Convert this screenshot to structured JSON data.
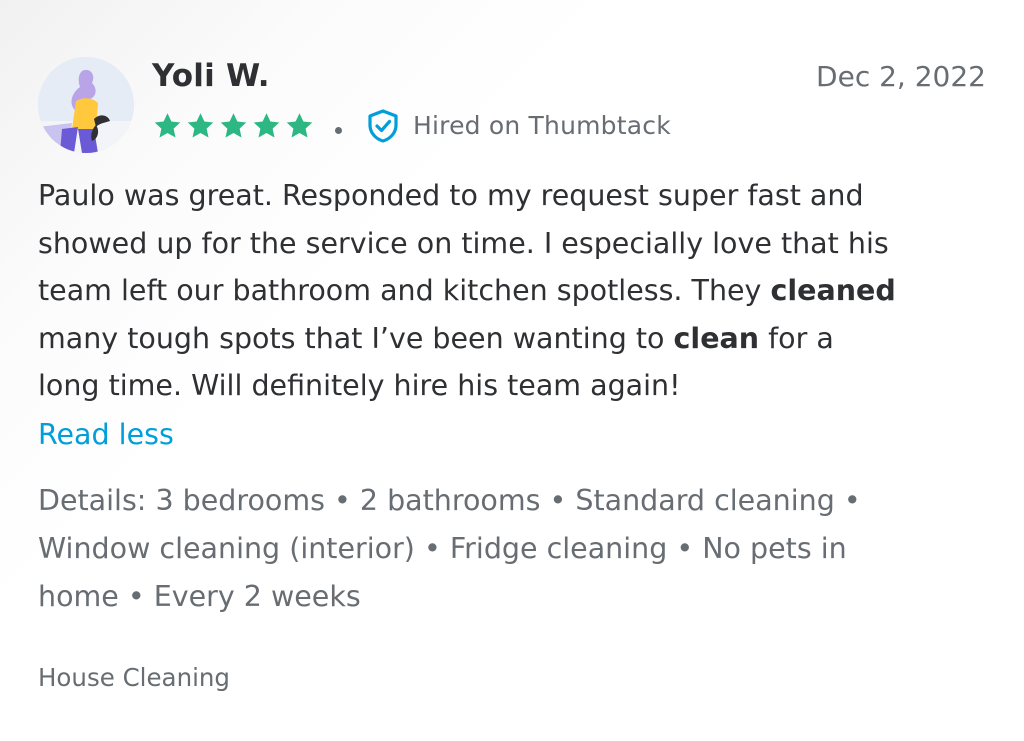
{
  "review": {
    "reviewer_name": "Yoli W.",
    "date": "Dec 2, 2022",
    "rating": 5,
    "rating_max": 5,
    "star_color": "#2db783",
    "verified_label": "Hired on Thumbtack",
    "verified_icon": "shield-check-icon",
    "verified_color": "#009fd9",
    "text_lines": [
      [
        "Paulo was great. Responded to my request super fast and"
      ],
      [
        "showed up for the service on time. I especially love that his"
      ],
      [
        "team left our bathroom and kitchen spotless. They ",
        "cleaned"
      ],
      [
        "many tough spots that I’ve been wanting to ",
        "clean",
        " for a"
      ],
      [
        "long time. Will definitely hire his team again!"
      ]
    ],
    "toggle_label": "Read less",
    "toggle_color": "#009fd9",
    "details_lines": [
      "Details: 3 bedrooms • 2 bathrooms • Standard cleaning •",
      "Window cleaning (interior) • Fridge cleaning • No pets in",
      "home • Every 2 weeks"
    ],
    "category": "House Cleaning"
  }
}
